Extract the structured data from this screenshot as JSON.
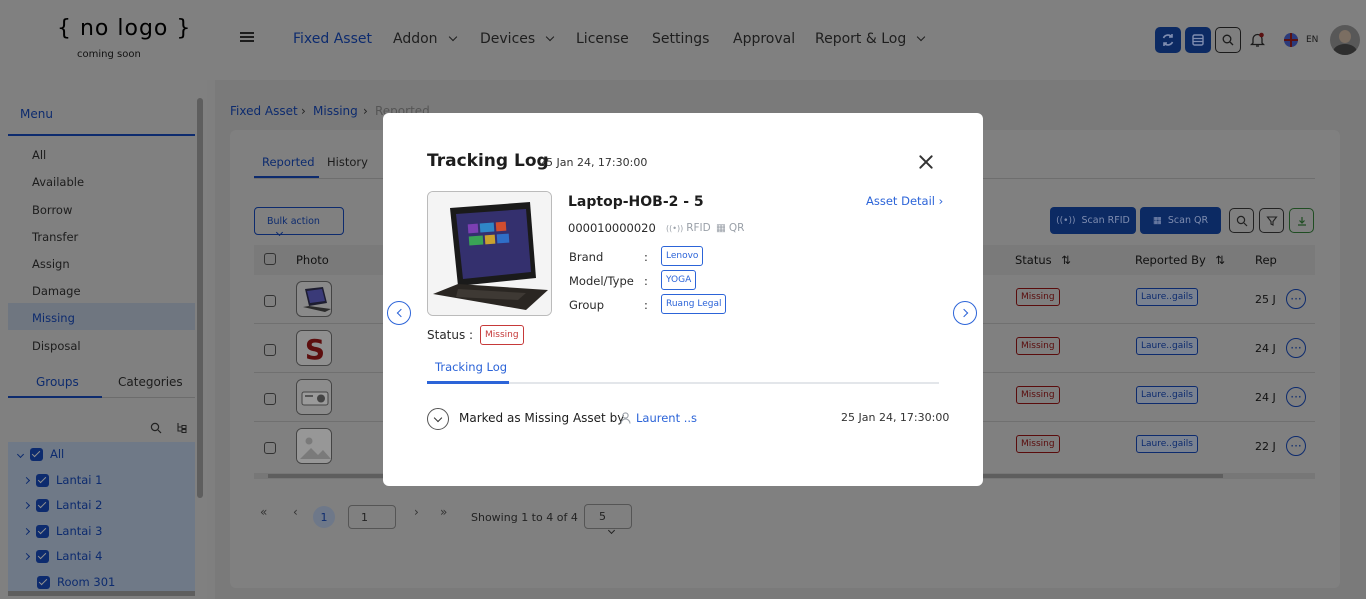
{
  "header": {
    "logo_main": "{ no logo }",
    "logo_sub": "coming soon",
    "nav": [
      {
        "label": "Fixed Asset",
        "active": true
      },
      {
        "label": "Addon",
        "dropdown": true
      },
      {
        "label": "Devices",
        "dropdown": true
      },
      {
        "label": "License"
      },
      {
        "label": "Settings"
      },
      {
        "label": "Approval"
      },
      {
        "label": "Report & Log",
        "dropdown": true
      }
    ],
    "language": "EN"
  },
  "sidebar": {
    "menu_title": "Menu",
    "items": [
      "All",
      "Available",
      "Borrow",
      "Transfer",
      "Assign",
      "Damage",
      "Missing",
      "Disposal"
    ],
    "active_item": "Missing",
    "tabs": [
      "Groups",
      "Categories"
    ],
    "tree": [
      {
        "label": "All",
        "expanded": true
      },
      {
        "label": "Lantai 1"
      },
      {
        "label": "Lantai 2"
      },
      {
        "label": "Lantai 3"
      },
      {
        "label": "Lantai 4"
      },
      {
        "label": "Room 301"
      }
    ]
  },
  "breadcrumb": [
    "Fixed Asset",
    "Missing",
    "Reported"
  ],
  "main_tabs": [
    "Reported",
    "History"
  ],
  "toolbar": {
    "bulk_action": "Bulk action",
    "scan_rfid": "Scan RFID",
    "scan_qr": "Scan QR"
  },
  "table": {
    "headers": {
      "photo": "Photo",
      "status": "Status",
      "reported_by": "Reported By",
      "rep": "Rep"
    },
    "rows": [
      {
        "status": "Missing",
        "reported_by": "Laure..gails",
        "rep": "25 J"
      },
      {
        "status": "Missing",
        "reported_by": "Laure..gails",
        "rep": "24 J"
      },
      {
        "status": "Missing",
        "reported_by": "Laure..gails",
        "rep": "24 J"
      },
      {
        "status": "Missing",
        "reported_by": "Laure..gails",
        "rep": "22 J"
      }
    ]
  },
  "pagination": {
    "current": "1",
    "page_input": "1",
    "showing": "Showing 1 to 4 of 4",
    "per_page": "5"
  },
  "modal": {
    "title": "Tracking Log",
    "date": "25 Jan 24, 17:30:00",
    "asset_name": "Laptop-HOB-2 - 5",
    "asset_detail_link": "Asset Detail",
    "asset_code": "000010000020",
    "tag_rfid": "RFID",
    "tag_qr": "QR",
    "fields": [
      {
        "label": "Brand",
        "value": "Lenovo"
      },
      {
        "label": "Model/Type",
        "value": "YOGA"
      },
      {
        "label": "Group",
        "value": "Ruang Legal"
      }
    ],
    "status_label": "Status :",
    "status_value": "Missing",
    "tab": "Tracking Log",
    "log": {
      "text": "Marked as Missing Asset by",
      "user": "Laurent ..s",
      "date": "25 Jan 24, 17:30:00"
    }
  },
  "colors": {
    "accent": "#2c64d8",
    "status_red": "#c63939",
    "overlay": "#808080"
  }
}
